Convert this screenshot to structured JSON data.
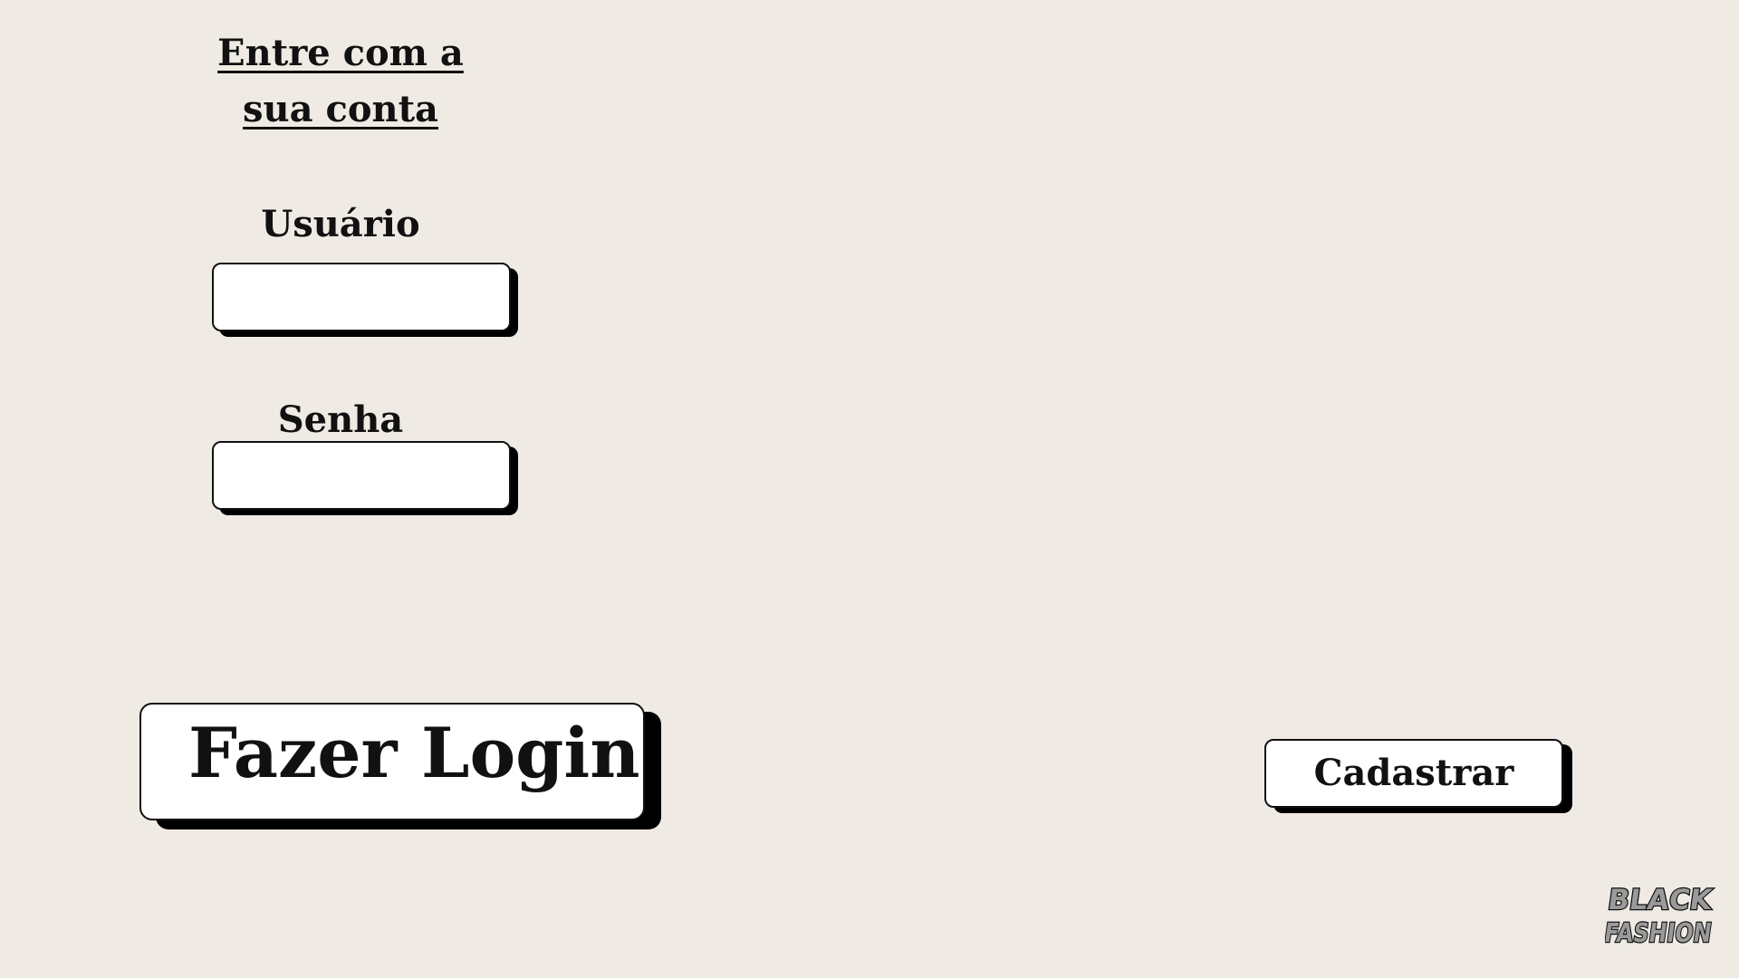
{
  "login": {
    "title": "Entre com a sua conta",
    "user_label": "Usuário",
    "user_value": "",
    "password_label": "Senha",
    "password_value": "",
    "login_button": "Fazer Login",
    "register_button": "Cadastrar"
  },
  "logo": {
    "line1": "BLACK",
    "line2": "FASHION",
    "fill_color": "#9a9a9a",
    "outline_color": "#111111"
  },
  "colors": {
    "background": "#efebe4",
    "box_fill": "#ffffff",
    "shadow": "#000000"
  }
}
